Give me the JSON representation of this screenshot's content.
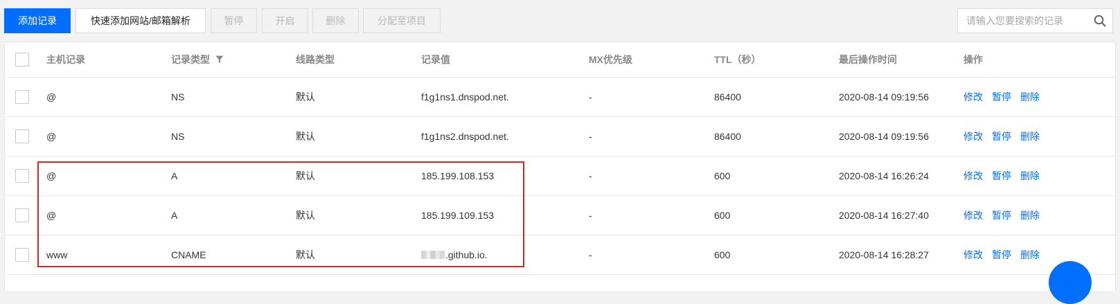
{
  "toolbar": {
    "add_record": "添加记录",
    "quick_add": "快速添加网站/邮箱解析",
    "pause": "暂停",
    "enable": "开启",
    "delete": "删除",
    "assign": "分配至项目"
  },
  "search": {
    "placeholder": "请输入您要搜索的记录"
  },
  "table": {
    "headers": {
      "host": "主机记录",
      "type": "记录类型",
      "line": "线路类型",
      "value": "记录值",
      "mx": "MX优先级",
      "ttl": "TTL（秒）",
      "time": "最后操作时间",
      "ops": "操作"
    },
    "ops": {
      "edit": "修改",
      "pause": "暂停",
      "delete": "删除"
    },
    "rows": [
      {
        "host": "@",
        "type": "NS",
        "line": "默认",
        "value": "f1g1ns1.dnspod.net.",
        "mx": "-",
        "ttl": "86400",
        "time": "2020-08-14 09:19:56"
      },
      {
        "host": "@",
        "type": "NS",
        "line": "默认",
        "value": "f1g1ns2.dnspod.net.",
        "mx": "-",
        "ttl": "86400",
        "time": "2020-08-14 09:19:56"
      },
      {
        "host": "@",
        "type": "A",
        "line": "默认",
        "value": "185.199.108.153",
        "mx": "-",
        "ttl": "600",
        "time": "2020-08-14 16:26:24"
      },
      {
        "host": "@",
        "type": "A",
        "line": "默认",
        "value": "185.199.109.153",
        "mx": "-",
        "ttl": "600",
        "time": "2020-08-14 16:27:40"
      },
      {
        "host": "www",
        "type": "CNAME",
        "line": "默认",
        "value": ".github.io.",
        "mx": "-",
        "ttl": "600",
        "time": "2020-08-14 16:28:27"
      }
    ]
  },
  "colors": {
    "primary": "#006eff",
    "highlight": "#e0221f"
  }
}
